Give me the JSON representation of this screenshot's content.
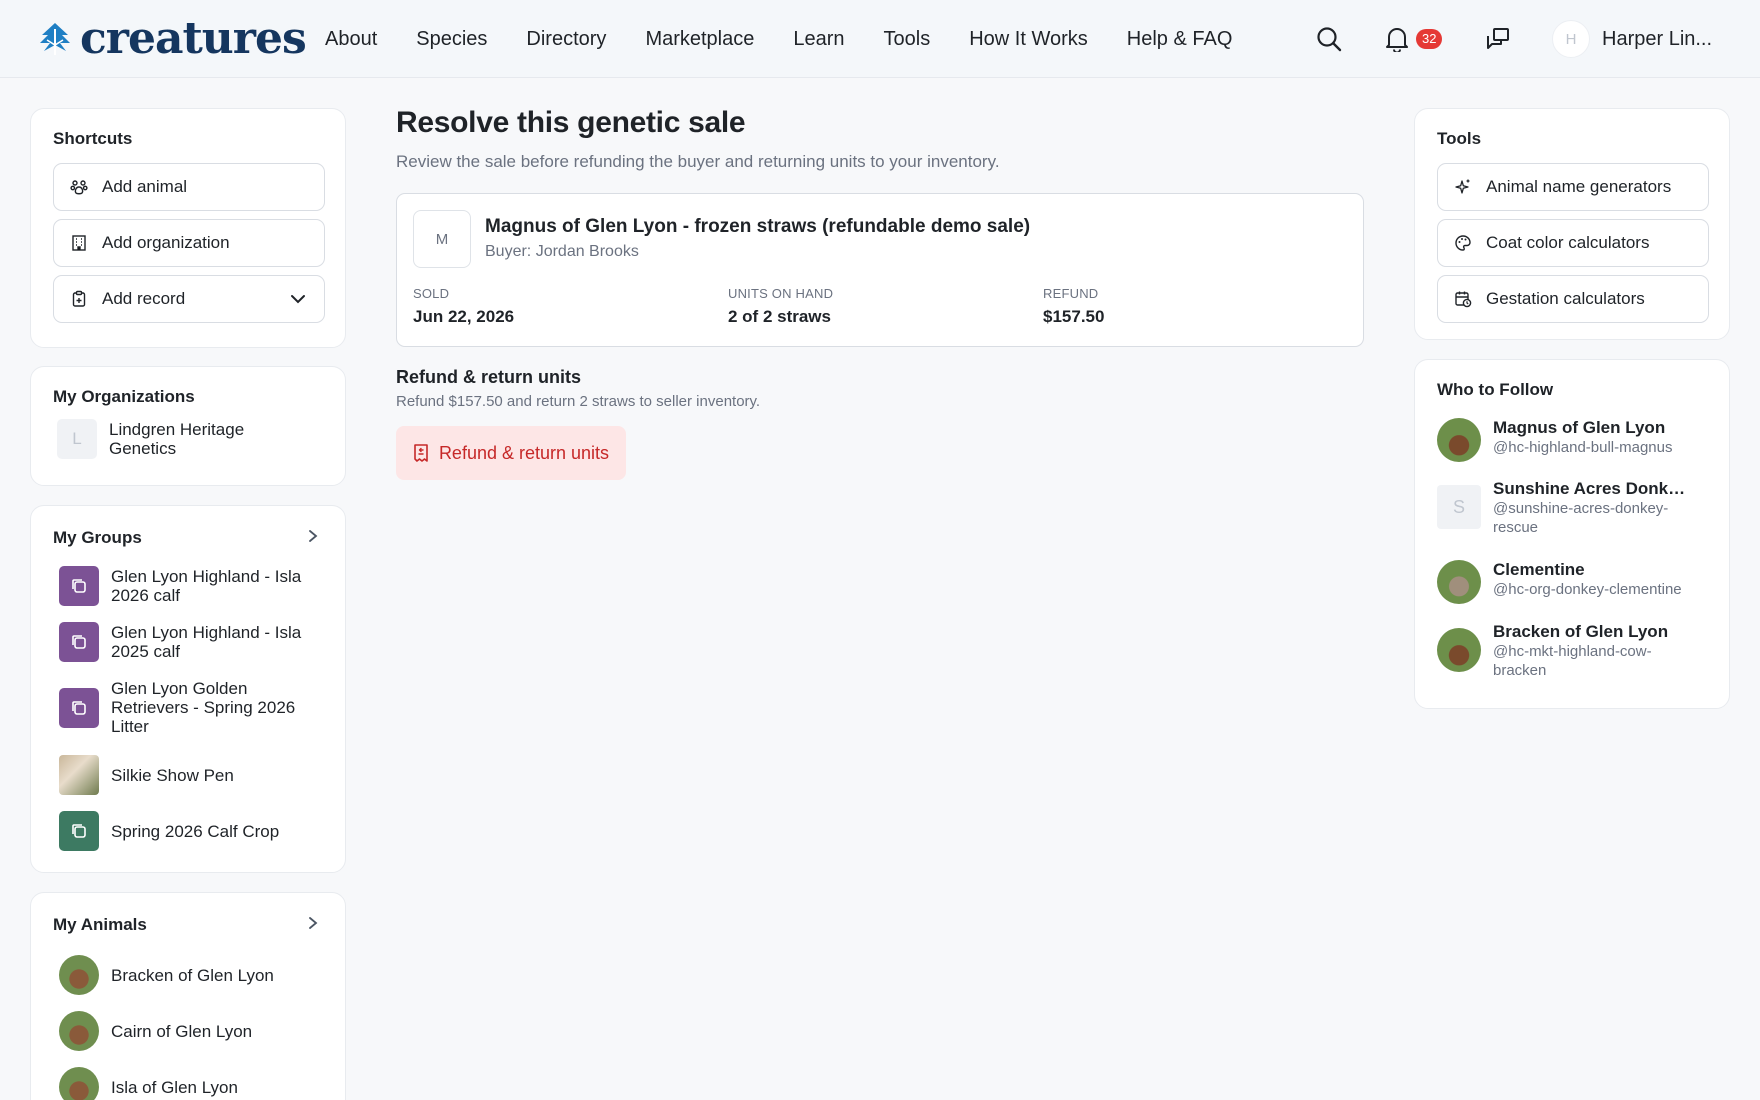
{
  "brand": {
    "name": "creatures"
  },
  "nav": {
    "items": [
      "About",
      "Species",
      "Directory",
      "Marketplace",
      "Learn",
      "Tools",
      "How It Works",
      "Help & FAQ"
    ]
  },
  "header": {
    "notification_count": "32",
    "user_initial": "H",
    "user_name": "Harper Lin..."
  },
  "shortcuts": {
    "title": "Shortcuts",
    "items": [
      {
        "label": "Add animal",
        "icon": "paw-icon"
      },
      {
        "label": "Add organization",
        "icon": "building-icon"
      },
      {
        "label": "Add record",
        "icon": "clipboard-icon"
      }
    ]
  },
  "organizations": {
    "title": "My Organizations",
    "items": [
      {
        "initial": "L",
        "label": "Lindgren Heritage Genetics"
      }
    ]
  },
  "groups": {
    "title": "My Groups",
    "items": [
      {
        "label": "Glen Lyon Highland - Isla 2026 calf"
      },
      {
        "label": "Glen Lyon Highland - Isla 2025 calf"
      },
      {
        "label": "Glen Lyon Golden Retrievers - Spring 2026 Litter"
      },
      {
        "label": "Silkie Show Pen"
      },
      {
        "label": "Spring 2026 Calf Crop"
      }
    ]
  },
  "animals": {
    "title": "My Animals",
    "items": [
      {
        "label": "Bracken of Glen Lyon"
      },
      {
        "label": "Cairn of Glen Lyon"
      },
      {
        "label": "Isla of Glen Lyon"
      }
    ]
  },
  "main": {
    "title": "Resolve this genetic sale",
    "subtitle": "Review the sale before refunding the buyer and returning units to your inventory.",
    "sale": {
      "initial": "M",
      "title": "Magnus of Glen Lyon - frozen straws (refundable demo sale)",
      "buyer": "Buyer: Jordan Brooks",
      "stats": [
        {
          "label": "SOLD",
          "value": "Jun 22, 2026"
        },
        {
          "label": "UNITS ON HAND",
          "value": "2 of 2 straws"
        },
        {
          "label": "REFUND",
          "value": "$157.50"
        }
      ]
    },
    "refund_section": {
      "heading": "Refund & return units",
      "description": "Refund $157.50 and return 2 straws to seller inventory.",
      "button_label": "Refund & return units"
    }
  },
  "tools": {
    "title": "Tools",
    "items": [
      {
        "label": "Animal name generators",
        "icon": "sparkle-icon"
      },
      {
        "label": "Coat color calculators",
        "icon": "palette-icon"
      },
      {
        "label": "Gestation calculators",
        "icon": "calendar-icon"
      }
    ]
  },
  "follow": {
    "title": "Who to Follow",
    "items": [
      {
        "name": "Magnus of Glen Lyon",
        "handle": "@hc-highland-bull-magnus"
      },
      {
        "name": "Sunshine Acres Donkey ...",
        "handle": "@sunshine-acres-donkey-rescue",
        "initial": "S"
      },
      {
        "name": "Clementine",
        "handle": "@hc-org-donkey-clementine"
      },
      {
        "name": "Bracken of Glen Lyon",
        "handle": "@hc-mkt-highland-cow-bracken"
      }
    ]
  },
  "colors": {
    "brand": "#15365f",
    "danger": "#c62828",
    "danger_bg": "#fde6e6",
    "group_purple": "#7c5295",
    "group_green": "#3d7a62"
  }
}
